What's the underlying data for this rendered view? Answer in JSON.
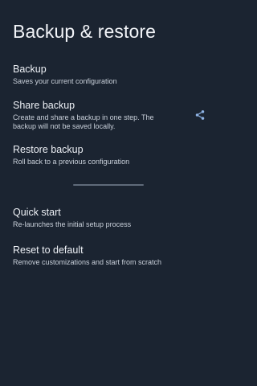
{
  "page": {
    "title": "Backup & restore"
  },
  "items": {
    "backup": {
      "title": "Backup",
      "summary": "Saves your current configuration"
    },
    "share": {
      "title": "Share backup",
      "summary": "Create and share a backup in one step. The backup will not be saved locally.",
      "icon": "share-icon"
    },
    "restore": {
      "title": "Restore backup",
      "summary": "Roll back to a previous configuration"
    },
    "quick_start": {
      "title": "Quick start",
      "summary": "Re-launches the initial setup process"
    },
    "reset": {
      "title": "Reset to default",
      "summary": "Remove customizations and start from scratch"
    }
  },
  "colors": {
    "background": "#1b2431",
    "accent_icon": "#8fb4e6",
    "divider": "#5f6a79"
  }
}
